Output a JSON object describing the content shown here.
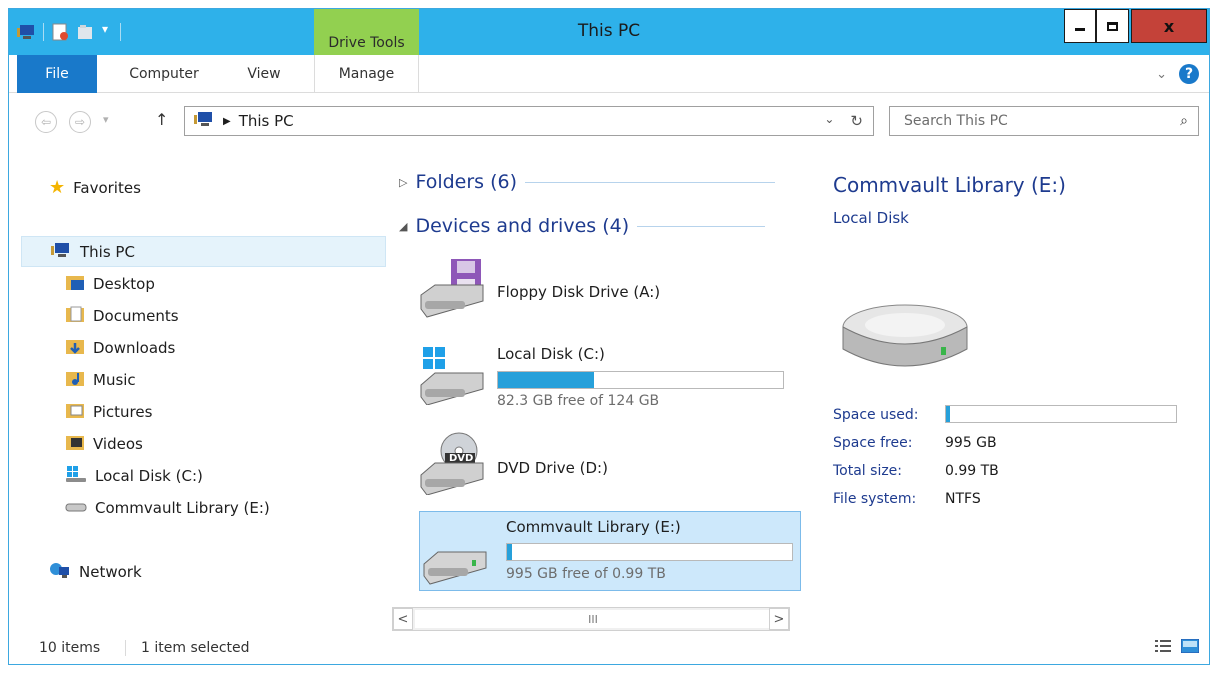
{
  "window": {
    "title": "This PC",
    "context_tab_label": "Drive Tools"
  },
  "window_controls": {
    "close_label": "x"
  },
  "ribbon": {
    "tabs": [
      {
        "label": "File"
      },
      {
        "label": "Computer"
      },
      {
        "label": "View"
      },
      {
        "label": "Manage"
      }
    ]
  },
  "address": {
    "path_label": "This PC",
    "search_placeholder": "Search This PC"
  },
  "nav": {
    "favorites": "Favorites",
    "this_pc": "This PC",
    "items": [
      {
        "label": "Desktop"
      },
      {
        "label": "Documents"
      },
      {
        "label": "Downloads"
      },
      {
        "label": "Music"
      },
      {
        "label": "Pictures"
      },
      {
        "label": "Videos"
      },
      {
        "label": "Local Disk (C:)"
      },
      {
        "label": "Commvault Library (E:)"
      }
    ],
    "network": "Network"
  },
  "content": {
    "folders_header": "Folders (6)",
    "devices_header": "Devices and drives (4)",
    "drives": [
      {
        "name": "Floppy Disk Drive (A:)",
        "free_text": "",
        "used_fraction": null
      },
      {
        "name": "Local Disk (C:)",
        "free_text": "82.3 GB free of 124 GB",
        "used_fraction": 0.336
      },
      {
        "name": "DVD Drive (D:)",
        "free_text": "",
        "used_fraction": null,
        "badge": "DVD"
      },
      {
        "name": "Commvault Library (E:)",
        "free_text": "995 GB free of 0.99 TB",
        "used_fraction": 0.018
      }
    ],
    "scroll_thumb_label": "III"
  },
  "details": {
    "title": "Commvault Library (E:)",
    "subtitle": "Local Disk",
    "space_used_label": "Space used:",
    "space_used_fraction": 0.018,
    "space_free_label": "Space free:",
    "space_free_value": "995 GB",
    "total_size_label": "Total size:",
    "total_size_value": "0.99 TB",
    "file_system_label": "File system:",
    "file_system_value": "NTFS"
  },
  "status": {
    "items_count": "10 items",
    "selection": "1 item selected"
  },
  "colors": {
    "titlebar": "#2eb1ea",
    "file_tab": "#1979ca",
    "drive_tools": "#92d050",
    "bar_fill": "#26a0da",
    "close_button": "#c44239"
  }
}
